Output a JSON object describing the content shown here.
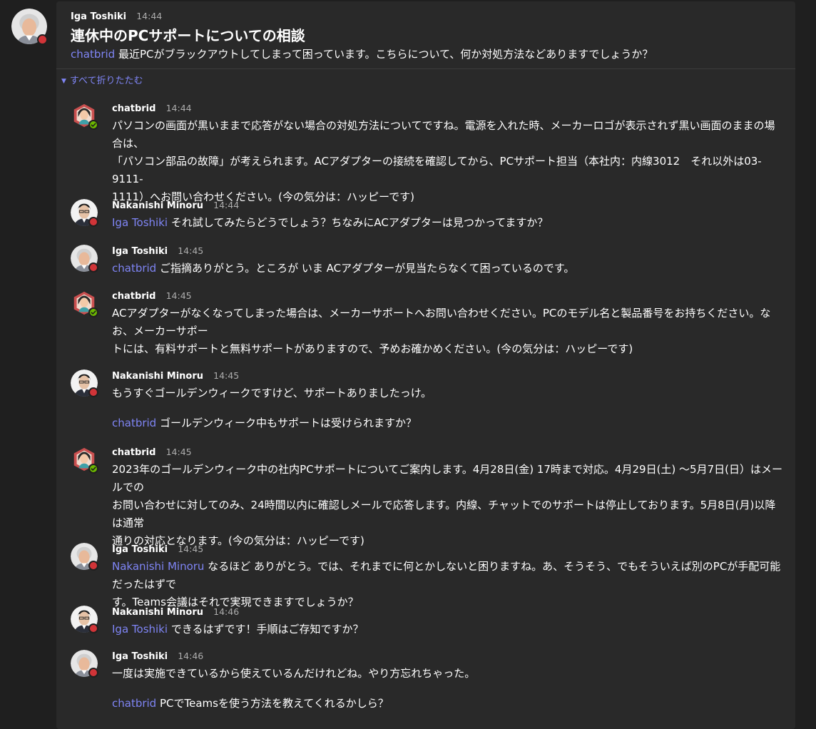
{
  "root": {
    "author": "Iga Toshiki",
    "time": "14:44",
    "subject": "連休中のPCサポートについての相談",
    "mention": "chatbrid",
    "text": " 最近PCがブラックアウトしてしまって困っています。こちらについて、何か対処方法などありますでしょうか？"
  },
  "collapse_label": "すべて折りたたむ",
  "colors": {
    "mention": "#7f85f5",
    "busy": "#d13438",
    "available": "#6bb700",
    "background": "#1f1f1f",
    "card": "#292929"
  },
  "replies": [
    {
      "author": "chatbrid",
      "time": "14:44",
      "avatar": "bot-avatar",
      "lines": [
        "パソコンの画面が黒いままで応答がない場合の対処方法についてですね。電源を入れた時、メーカーロゴが表示されず黒い画面のままの場合は、",
        "「パソコン部品の故障」が考えられます。ACアダプターの接続を確認してから、PCサポート担当（本社内：内線3012　それ以外は03-9111-",
        "1111）へお問い合わせください。(今の気分は：ハッピーです)"
      ]
    },
    {
      "author": "Nakanishi Minoru",
      "time": "14:44",
      "avatar": "person-avatar",
      "mention": "Iga Toshiki",
      "text": " それ試してみたらどうでしょう？ちなみにACアダプターは見つかってますか？"
    },
    {
      "author": "Iga Toshiki",
      "time": "14:45",
      "avatar": "person-avatar",
      "mention": "chatbrid",
      "text": " ご指摘ありがとう。ところが いま ACアダプターが見当たらなくて困っているのです。"
    },
    {
      "author": "chatbrid",
      "time": "14:45",
      "avatar": "bot-avatar",
      "lines": [
        "ACアダプターがなくなってしまった場合は、メーカーサポートへお問い合わせください。PCのモデル名と製品番号をお持ちください。なお、メーカーサポー",
        "トには、有料サポートと無料サポートがありますので、予めお確かめください。(今の気分は：ハッピーです)"
      ]
    },
    {
      "author": "Nakanishi Minoru",
      "time": "14:45",
      "avatar": "person-avatar",
      "text": "もうすぐゴールデンウィークですけど、サポートありましたっけ。",
      "mention2": "chatbrid",
      "text2": " ゴールデンウィーク中もサポートは受けられますか？"
    },
    {
      "author": "chatbrid",
      "time": "14:45",
      "avatar": "bot-avatar",
      "lines": [
        "2023年のゴールデンウィーク中の社内PCサポートについてご案内します。4月28日(金) 17時まで対応。4月29日(土) 〜5月7日(日）はメールでの",
        "お問い合わせに対してのみ、24時間以内に確認しメールで応答します。内線、チャットでのサポートは停止しております。5月8日(月)以降は通常",
        "通りの対応となります。(今の気分は：ハッピーです)"
      ]
    },
    {
      "author": "Iga Toshiki",
      "time": "14:45",
      "avatar": "person-avatar",
      "mention": "Nakanishi Minoru",
      "lines_first": " なるほど ありがとう。では、それまでに何とかしないと困りますね。あ、そうそう、でもそういえば別のPCが手配可能だったはずで",
      "line_second": "す。Teams会議はそれで実現できますでしょうか？"
    },
    {
      "author": "Nakanishi Minoru",
      "time": "14:46",
      "avatar": "person-avatar",
      "mention": "Iga Toshiki",
      "text": " できるはずです！手順はご存知ですか？"
    },
    {
      "author": "Iga Toshiki",
      "time": "14:46",
      "avatar": "person-avatar",
      "text": "一度は実施できているから使えているんだけれどね。やり方忘れちゃった。",
      "mention2": "chatbrid",
      "text2": " PCでTeamsを使う方法を教えてくれるかしら？"
    }
  ]
}
